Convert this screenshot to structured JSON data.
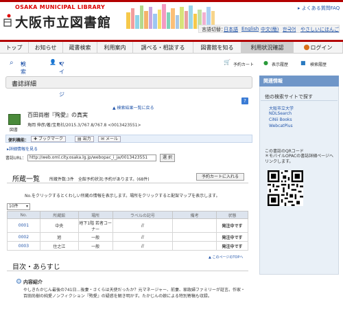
{
  "header": {
    "logo_en": "OSAKA MUNICIPAL LIBRARY",
    "logo_jp": "大阪市立図書館",
    "faq": "よくある質問FAQ",
    "lang_label": "言語切替：",
    "languages": [
      "日本語",
      "English",
      "中文(簡)",
      "한국어",
      "やさしいにほんご"
    ]
  },
  "nav": [
    "トップ",
    "お知らせ",
    "蔵書検索",
    "利用案内",
    "調べる・相談する",
    "図書館を知る",
    "利用状況確認",
    "ログイン"
  ],
  "subnav": {
    "search": "検索",
    "mypage": "マイページ",
    "cart": "予約カート",
    "history": "表示履歴",
    "search_history": "検索履歴"
  },
  "detail": {
    "heading": "書誌詳細",
    "back_link": "検索結果一覧に戻る",
    "title": "百田尚樹『殉愛』の真実",
    "meta": "角岡 伸彦/著/宝島社/2015.3/767.8/767.8 <0013423551>",
    "type_label": "図書",
    "tools_label": "便利機能：",
    "bookmark": "ブックマーク",
    "print": "出力",
    "mail": "メール",
    "more_info": "詳細情報を見る",
    "url_label": "書誌URL：",
    "url": "http://web.oml.city.osaka.lg.jp/webopac_i_ja/0013423551",
    "copy_button": "選 択"
  },
  "holdings": {
    "heading": "所蔵一覧",
    "summary": "所蔵件数:3件　全館予約状況:予約があります。(68件)",
    "add_cart": "予約カートに入れる",
    "note": "No.をクリックするとくわしい所蔵の情報を表示します。場所をクリックすると配架マップを表示します。",
    "per_page": "10件",
    "columns": [
      "No.",
      "所蔵館",
      "場所",
      "ラベルの記号",
      "備考",
      "状態"
    ],
    "rows": [
      {
        "no": "0001",
        "library": "中央",
        "location": "地下1階 若者コーナー",
        "label": "//",
        "note": "",
        "status": "発注中です"
      },
      {
        "no": "0002",
        "library": "旭",
        "location": "一般",
        "label": "//",
        "note": "",
        "status": "発注中です"
      },
      {
        "no": "0003",
        "library": "住之江",
        "location": "一般",
        "label": "//",
        "note": "",
        "status": "発注中です"
      }
    ],
    "top_link": "このページのTOPへ"
  },
  "toc": {
    "heading": "目次・あらすじ",
    "intro_label": "内容紹介",
    "intro_text": "やしきたかじん最後の741日…後妻・さくらは天使だったか？元マネージャー、前妻、家政婦ファミリーが証言。作家・百田尚樹の純愛ノンフィクション『殉愛』の疑惑を解き明かす。たかじんの娘による特別寄稿も収録。"
  },
  "sidebar": {
    "heading": "関連情報",
    "other_search": "他の検索サイトで探す",
    "links": [
      "大阪市立大学",
      "NDLSearch",
      "CiNii Books",
      "WebcatPlus"
    ],
    "qr_title": "この書誌のQRコード",
    "qr_note": "＊モバイルOPACの書誌詳細ページへリンクします。"
  }
}
